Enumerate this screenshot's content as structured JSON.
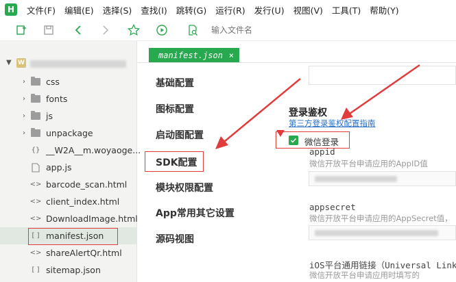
{
  "app": {
    "logo_letter": "H"
  },
  "menu": [
    "文件(F)",
    "编辑(E)",
    "选择(S)",
    "查找(I)",
    "跳转(G)",
    "运行(R)",
    "发行(U)",
    "视图(V)",
    "工具(T)",
    "帮助(Y)"
  ],
  "toolbar": {
    "icons": [
      "new-file-icon",
      "save-icon",
      "back-icon",
      "forward-icon",
      "star-icon",
      "run-icon",
      "file-search-icon"
    ],
    "file_input_placeholder": "输入文件名"
  },
  "tree": {
    "root_icon_letter": "W",
    "items": [
      {
        "label": "css",
        "type": "folder"
      },
      {
        "label": "fonts",
        "type": "folder"
      },
      {
        "label": "js",
        "type": "folder"
      },
      {
        "label": "unpackage",
        "type": "folder"
      },
      {
        "label": "__W2A__m.woyaoge...",
        "type": "json"
      },
      {
        "label": "app.js",
        "type": "js"
      },
      {
        "label": "barcode_scan.html",
        "type": "html"
      },
      {
        "label": "client_index.html",
        "type": "html"
      },
      {
        "label": "DownloadImage.html",
        "type": "html"
      },
      {
        "label": "manifest.json",
        "type": "json",
        "selected": true
      },
      {
        "label": "shareAlertQr.html",
        "type": "html"
      },
      {
        "label": "sitemap.json",
        "type": "json"
      }
    ]
  },
  "editor_tab": {
    "label": "manifest.json",
    "close": "×"
  },
  "nav": [
    "基础配置",
    "图标配置",
    "启动图配置",
    "SDK配置",
    "模块权限配置",
    "App常用其它设置",
    "源码视图"
  ],
  "login": {
    "title": "登录鉴权",
    "guide_link": "第三方登录鉴权配置指南",
    "checkbox_label": "微信登录",
    "checked": true,
    "appid_label": "appid",
    "appid_hint": "微信开放平台申请应用的AppID值",
    "appsecret_label": "appsecret",
    "appsecret_hint": "微信开放平台申请应用的AppSecret值，",
    "universal_label": "iOS平台通用链接（Universal Links",
    "universal_hint": "微信开放平台申请应用时填写的"
  },
  "colors": {
    "accent": "#28a94f",
    "annotation_red": "#e23b3b",
    "link": "#2a6fc9"
  }
}
